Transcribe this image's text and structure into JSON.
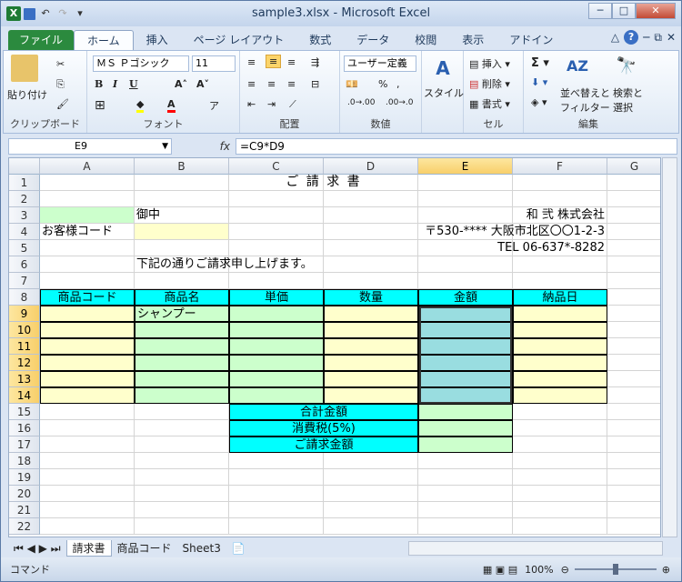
{
  "window": {
    "title": "sample3.xlsx  -  Microsoft Excel"
  },
  "qat": {
    "app_icon": "X",
    "redo_icon": "↷",
    "undo_icon": "↶",
    "save_icon": "▪"
  },
  "winctl": {
    "min": "─",
    "max": "□",
    "close": "✕"
  },
  "ribbon_tabs": [
    "ファイル",
    "ホーム",
    "挿入",
    "ページ レイアウト",
    "数式",
    "データ",
    "校閲",
    "表示",
    "アドイン"
  ],
  "ribbon": {
    "clipboard": {
      "paste": "貼り付け",
      "label": "クリップボード"
    },
    "font": {
      "name": "ＭＳ Ｐゴシック",
      "size": "11",
      "label": "フォント"
    },
    "align": {
      "label": "配置"
    },
    "number": {
      "format": "ユーザー定義",
      "label": "数値"
    },
    "style": {
      "btn": "スタイル"
    },
    "cells": {
      "insert": "挿入",
      "delete": "削除",
      "format": "書式",
      "label": "セル"
    },
    "edit": {
      "sort": "並べ替えと\nフィルター",
      "sort1": "並べ替えと",
      "sort2": "フィルター",
      "find1": "検索と",
      "find2": "選択",
      "label": "編集"
    }
  },
  "formula": {
    "cell": "E9",
    "fx": "fx",
    "value": "=C9*D9"
  },
  "columns": [
    "A",
    "B",
    "C",
    "D",
    "E",
    "F",
    "G"
  ],
  "rows": [
    "1",
    "2",
    "3",
    "4",
    "5",
    "6",
    "7",
    "8",
    "9",
    "10",
    "11",
    "12",
    "13",
    "14",
    "15",
    "16",
    "17",
    "18",
    "19",
    "20",
    "21",
    "22"
  ],
  "sheet": {
    "title": "ご 請 求 書",
    "b3": "御中",
    "company": "和 弐 株式会社",
    "a4": "お客様コード",
    "address": "〒530-**** 大阪市北区〇〇1-2-3",
    "tel": "TEL 06-637*-8282",
    "b6": "下記の通りご請求申し上げます。",
    "headers": [
      "商品コード",
      "商品名",
      "単価",
      "数量",
      "金額",
      "納品日"
    ],
    "b9": "シャンプー",
    "summary": [
      "合計金額",
      "消費税(5%)",
      "ご請求金額"
    ]
  },
  "sheet_tabs": [
    "請求書",
    "商品コード",
    "Sheet3"
  ],
  "status": {
    "mode": "コマンド",
    "zoom": "100%"
  },
  "colors": {
    "header_cyan": "#00ffff",
    "light_yellow": "#ffffcc",
    "light_green": "#ccffcc",
    "selection": "#99dde0"
  }
}
